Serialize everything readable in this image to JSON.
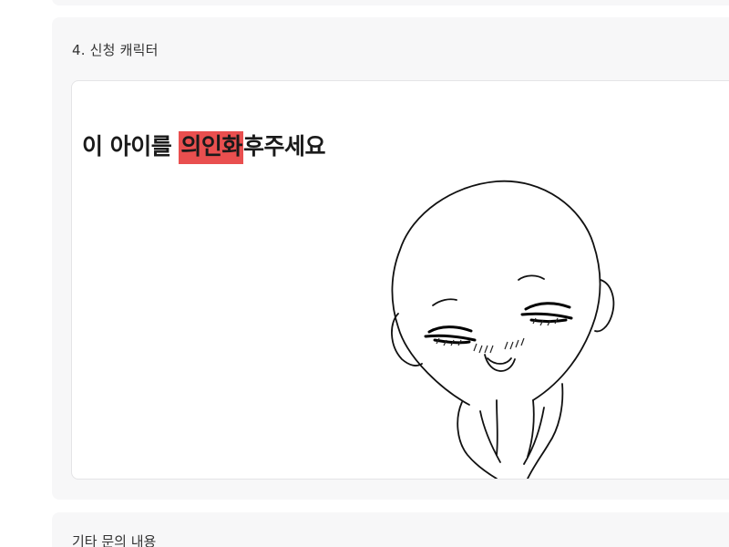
{
  "section": {
    "label": "4. 신청 캐릭터",
    "headline_before": "이 아이를 ",
    "headline_highlight": "의인화",
    "headline_after": "후주세요",
    "highlight_color": "#e94f4f"
  },
  "section2": {
    "label": "기타 문의 내용"
  }
}
